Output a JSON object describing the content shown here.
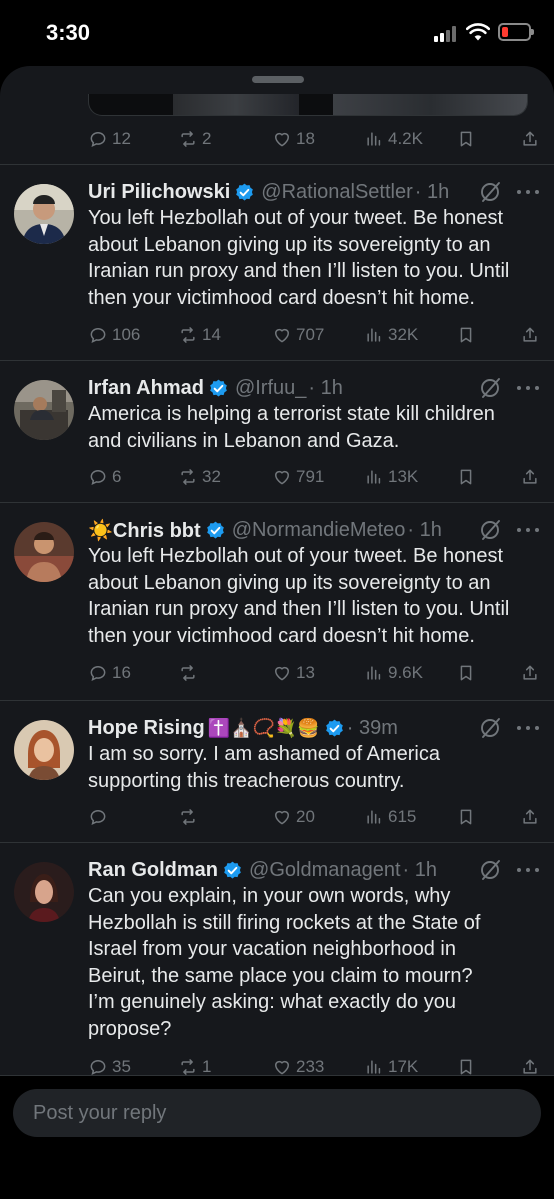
{
  "status_bar": {
    "time": "3:30",
    "colors": {
      "battery_low": "#ff3b30"
    }
  },
  "accent": "#1d9bf0",
  "top_actions": {
    "replies": "12",
    "reposts": "2",
    "likes": "18",
    "views": "4.2K"
  },
  "tweets": [
    {
      "name": "Uri Pilichowski",
      "verified": true,
      "handle": "@RationalSettler",
      "time": "· 1h",
      "text": [
        "You left Hezbollah out of your tweet. Be honest",
        "about Lebanon giving up its sovereignty to an",
        "Iranian run proxy and then I’ll listen to you. Until",
        "then your victimhood card doesn’t hit home."
      ],
      "actions": {
        "replies": "106",
        "reposts": "14",
        "likes": "707",
        "views": "32K"
      }
    },
    {
      "name": "Irfan Ahmad",
      "verified": true,
      "handle": "@Irfuu_",
      "time": "· 1h",
      "text": [
        "America is helping a terrorist state kill children",
        "and civilians in Lebanon and Gaza."
      ],
      "actions": {
        "replies": "6",
        "reposts": "32",
        "likes": "791",
        "views": "13K"
      }
    },
    {
      "name": "☀️Chris bbt",
      "verified": true,
      "handle": "@NormandieMeteo",
      "time": "· 1h",
      "text": [
        "You left Hezbollah out of your tweet. Be honest",
        "about Lebanon giving up its sovereignty to an",
        "Iranian run proxy and then I’ll listen to you. Until",
        "then your victimhood card doesn’t hit home."
      ],
      "actions": {
        "replies": "16",
        "reposts": "",
        "likes": "13",
        "views": "9.6K"
      }
    },
    {
      "name": "Hope Rising",
      "name_emoji": "✝️⛪📿💐🍔",
      "verified": true,
      "handle": "",
      "time": "· 39m",
      "text": [
        "I am so sorry.  I am ashamed of America",
        "supporting this treacherous country."
      ],
      "actions": {
        "replies": "",
        "reposts": "",
        "likes": "20",
        "views": "615"
      }
    },
    {
      "name": "Ran Goldman",
      "verified": true,
      "handle": "@Goldmanagent",
      "time": "· 1h",
      "text": [
        "Can you explain, in your own words, why",
        "Hezbollah is still firing rockets at the State of",
        "Israel from your vacation neighborhood in",
        "Beirut, the same place you claim to mourn?",
        "I’m genuinely asking: what exactly do you",
        "propose?"
      ],
      "actions": {
        "replies": "35",
        "reposts": "1",
        "likes": "233",
        "views": "17K"
      }
    }
  ],
  "reply": {
    "placeholder": "Post your reply"
  }
}
